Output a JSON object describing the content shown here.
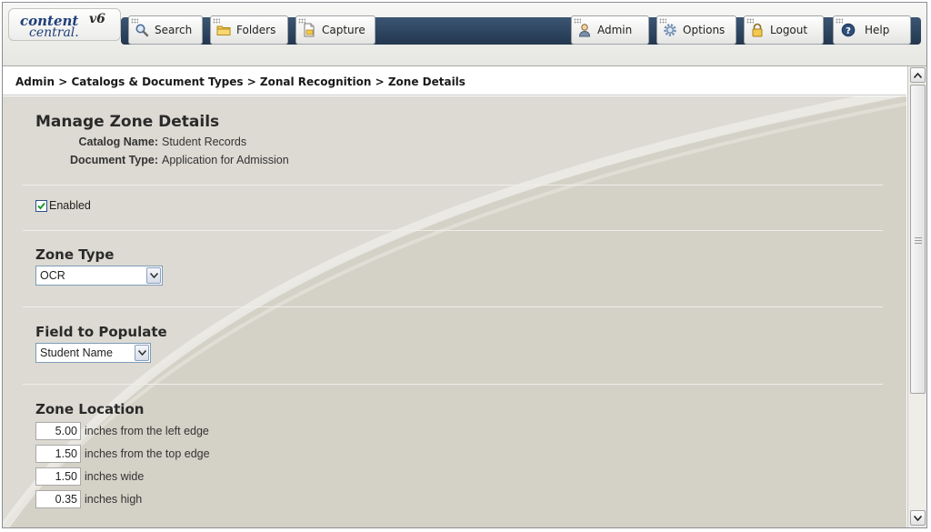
{
  "app": {
    "logo_line1": "content",
    "logo_line2": "central.",
    "version": "v6"
  },
  "toolbar": {
    "left_buttons": [
      {
        "label": "Search",
        "icon": "magnifier-icon"
      },
      {
        "label": "Folders",
        "icon": "folder-icon"
      },
      {
        "label": "Capture",
        "icon": "document-capture-icon"
      }
    ],
    "right_buttons": [
      {
        "label": "Admin",
        "icon": "user-admin-icon"
      },
      {
        "label": "Options",
        "icon": "gear-icon"
      },
      {
        "label": "Logout",
        "icon": "padlock-icon"
      },
      {
        "label": "Help",
        "icon": "help-icon"
      }
    ]
  },
  "breadcrumb": "Admin > Catalogs & Document Types > Zonal Recognition > Zone Details",
  "page": {
    "title": "Manage Zone Details",
    "catalog_label": "Catalog Name:",
    "catalog_value": "Student Records",
    "doctype_label": "Document Type:",
    "doctype_value": "Application for Admission"
  },
  "enabled": {
    "label": "Enabled",
    "checked": true
  },
  "zone_type": {
    "heading": "Zone Type",
    "selected": "OCR"
  },
  "field_to_populate": {
    "heading": "Field to Populate",
    "selected": "Student Name"
  },
  "zone_location": {
    "heading": "Zone Location",
    "rows": [
      {
        "value": "5.00",
        "label": "inches from the left edge"
      },
      {
        "value": "1.50",
        "label": "inches from the top edge"
      },
      {
        "value": "1.50",
        "label": "inches wide"
      },
      {
        "value": "0.35",
        "label": "inches high"
      }
    ]
  },
  "colors": {
    "toolbar_bar": "#2d4660",
    "content_bg": "#dcdad2",
    "link_blue": "#1f3f7a"
  }
}
